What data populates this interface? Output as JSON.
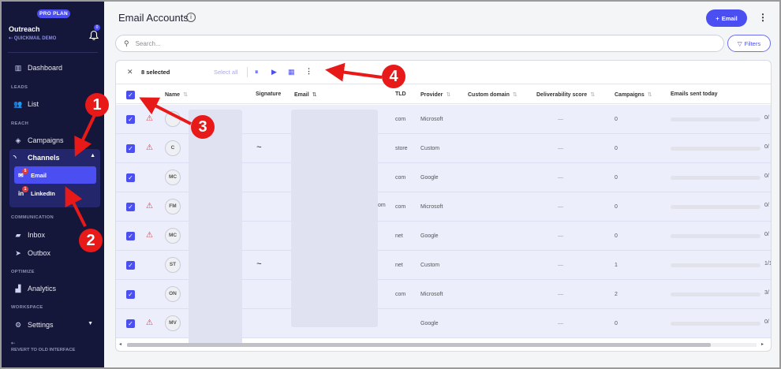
{
  "sidebar": {
    "plan_badge": "PRO PLAN",
    "org_name": "Outreach",
    "org_sub": "QUICKMAIL DEMO",
    "notification_count": "0",
    "nav": {
      "dashboard": "Dashboard",
      "leads_section": "LEADS",
      "list": "List",
      "reach_section": "REACH",
      "campaigns": "Campaigns",
      "channels": "Channels",
      "email": "Email",
      "email_badge": "5",
      "linkedin": "LinkedIn",
      "linkedin_badge": "1",
      "communication_section": "COMMUNICATION",
      "inbox": "Inbox",
      "outbox": "Outbox",
      "optimize_section": "OPTIMIZE",
      "analytics": "Analytics",
      "workspace_section": "WORKSPACE",
      "settings": "Settings"
    },
    "revert": "REVERT TO OLD INTERFACE"
  },
  "header": {
    "title": "Email Accounts",
    "add_button": "Email"
  },
  "search": {
    "placeholder": "Search..."
  },
  "filters_label": "Filters",
  "toolbar": {
    "selected_count": "8 selected",
    "select_all": "Select all"
  },
  "table": {
    "columns": {
      "name": "Name",
      "signature": "Signature",
      "email": "Email",
      "tld": "TLD",
      "provider": "Provider",
      "custom_domain": "Custom domain",
      "deliverability": "Deliverability score",
      "campaigns": "Campaigns",
      "sent_today": "Emails sent today"
    },
    "rows": [
      {
        "initials": "",
        "warning": true,
        "signature": "",
        "tld": "com",
        "provider": "Microsoft",
        "score": "—",
        "campaigns": "0",
        "sent": "0/"
      },
      {
        "initials": "C",
        "warning": true,
        "signature": "~",
        "tld": "store",
        "provider": "Custom",
        "score": "—",
        "campaigns": "0",
        "sent": "0/"
      },
      {
        "initials": "MC",
        "warning": false,
        "signature": "",
        "tld": "com",
        "provider": "Google",
        "score": "—",
        "campaigns": "0",
        "sent": "0/"
      },
      {
        "initials": "FM",
        "warning": true,
        "signature": "",
        "tld": "com",
        "provider": "Microsoft",
        "score": "—",
        "campaigns": "0",
        "sent": "0/"
      },
      {
        "initials": "MC",
        "warning": true,
        "signature": "",
        "tld": "net",
        "provider": "Google",
        "score": "—",
        "campaigns": "0",
        "sent": "0/"
      },
      {
        "initials": "ST",
        "warning": false,
        "signature": "~",
        "tld": "net",
        "provider": "Custom",
        "score": "—",
        "campaigns": "1",
        "sent": "1/1"
      },
      {
        "initials": "ON",
        "warning": false,
        "signature": "",
        "tld": "com",
        "provider": "Microsoft",
        "score": "—",
        "campaigns": "2",
        "sent": "3/"
      },
      {
        "initials": "MV",
        "warning": true,
        "signature": "",
        "tld": "",
        "provider": "Google",
        "score": "—",
        "campaigns": "0",
        "sent": "0/"
      }
    ],
    "email_fragment": "om"
  },
  "callouts": [
    "1",
    "2",
    "3",
    "4"
  ],
  "colors": {
    "accent": "#4b4ef0",
    "sidebar": "#14163a",
    "callout": "#e81919",
    "warning": "#e03b3b"
  }
}
